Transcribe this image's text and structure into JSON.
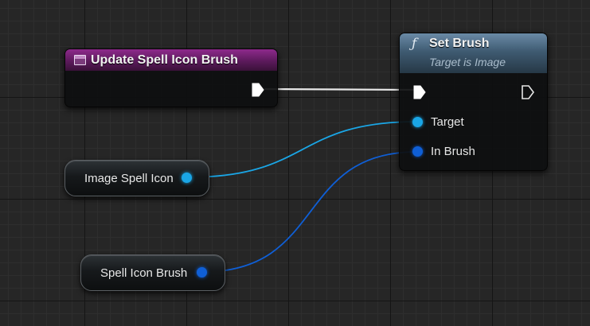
{
  "colors": {
    "grid_background": "#262626",
    "event_header": "#8e2a8c",
    "function_header": "#4a6a84",
    "exec_wire": "#ffffff",
    "object_pin": "#1aa6e6",
    "struct_pin": "#0f5fd6"
  },
  "event_node": {
    "title": "Update Spell Icon Brush",
    "icon": "event-graph-icon",
    "exec_out_icon": "exec-pin-icon"
  },
  "function_node": {
    "icon": "function-icon",
    "glyph": "ƒ",
    "title": "Set Brush",
    "subtitle": "Target is Image",
    "pins": {
      "target": "Target",
      "in_brush": "In Brush"
    }
  },
  "variables": {
    "image_spell_icon": "Image Spell Icon",
    "spell_icon_brush": "Spell Icon Brush"
  }
}
